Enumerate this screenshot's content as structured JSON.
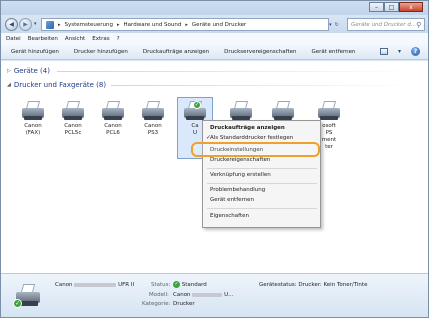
{
  "window": {
    "buttons": {
      "minimize": "–",
      "maximize": "□",
      "close": "x"
    }
  },
  "address": {
    "crumbs": [
      "Systemsteuerung",
      "Hardware und Sound",
      "Geräte und Drucker"
    ],
    "search_placeholder": "Geräte und Drucker d..."
  },
  "menu": [
    "Datei",
    "Bearbeiten",
    "Ansicht",
    "Extras",
    "?"
  ],
  "toolbar": {
    "buttons": [
      "Gerät hinzufügen",
      "Drucker hinzufügen",
      "Druckaufträge anzeigen",
      "Druckservereigenschaften",
      "Gerät entfernen"
    ]
  },
  "groups": {
    "devices": "Geräte (4)",
    "printers": "Drucker und Faxgeräte (8)"
  },
  "printers": [
    {
      "line1": "Canon",
      "line2": "(FAX)"
    },
    {
      "line1": "Canon",
      "line2": "PCL5c"
    },
    {
      "line1": "Canon",
      "line2": "PCL6"
    },
    {
      "line1": "Canon",
      "line2": "PS3"
    },
    {
      "line1": "Ca",
      "line2": "U"
    },
    {
      "line1": "",
      "line2": ""
    },
    {
      "line1": "",
      "line2": ""
    },
    {
      "line1": "osoft",
      "line2": "PS",
      "line3": "ment",
      "line4": "ter"
    }
  ],
  "context_menu": {
    "items": [
      "Druckaufträge anzeigen",
      "Als Standarddrucker festlegen",
      "Druckeinstellungen",
      "Druckereigenschaften",
      "Verknüpfung erstellen",
      "Problembehandlung",
      "Gerät entfernen",
      "Eigenschaften"
    ],
    "highlighted_index": 2
  },
  "details": {
    "name_prefix": "Canon",
    "name_suffix": "UFR II",
    "status_label": "Status:",
    "status_value": "Standard",
    "model_label": "Modell:",
    "model_prefix": "Canon",
    "model_suffix": "U...",
    "category_label": "Kategorie:",
    "category_value": "Drucker",
    "device_status": "Gerätestatus: Drucker: Kein Toner/Tinte"
  },
  "colors": {
    "group_heading": "#1f3c88",
    "highlight_ring": "#f0a02e",
    "status_ok": "#3fa13f"
  }
}
